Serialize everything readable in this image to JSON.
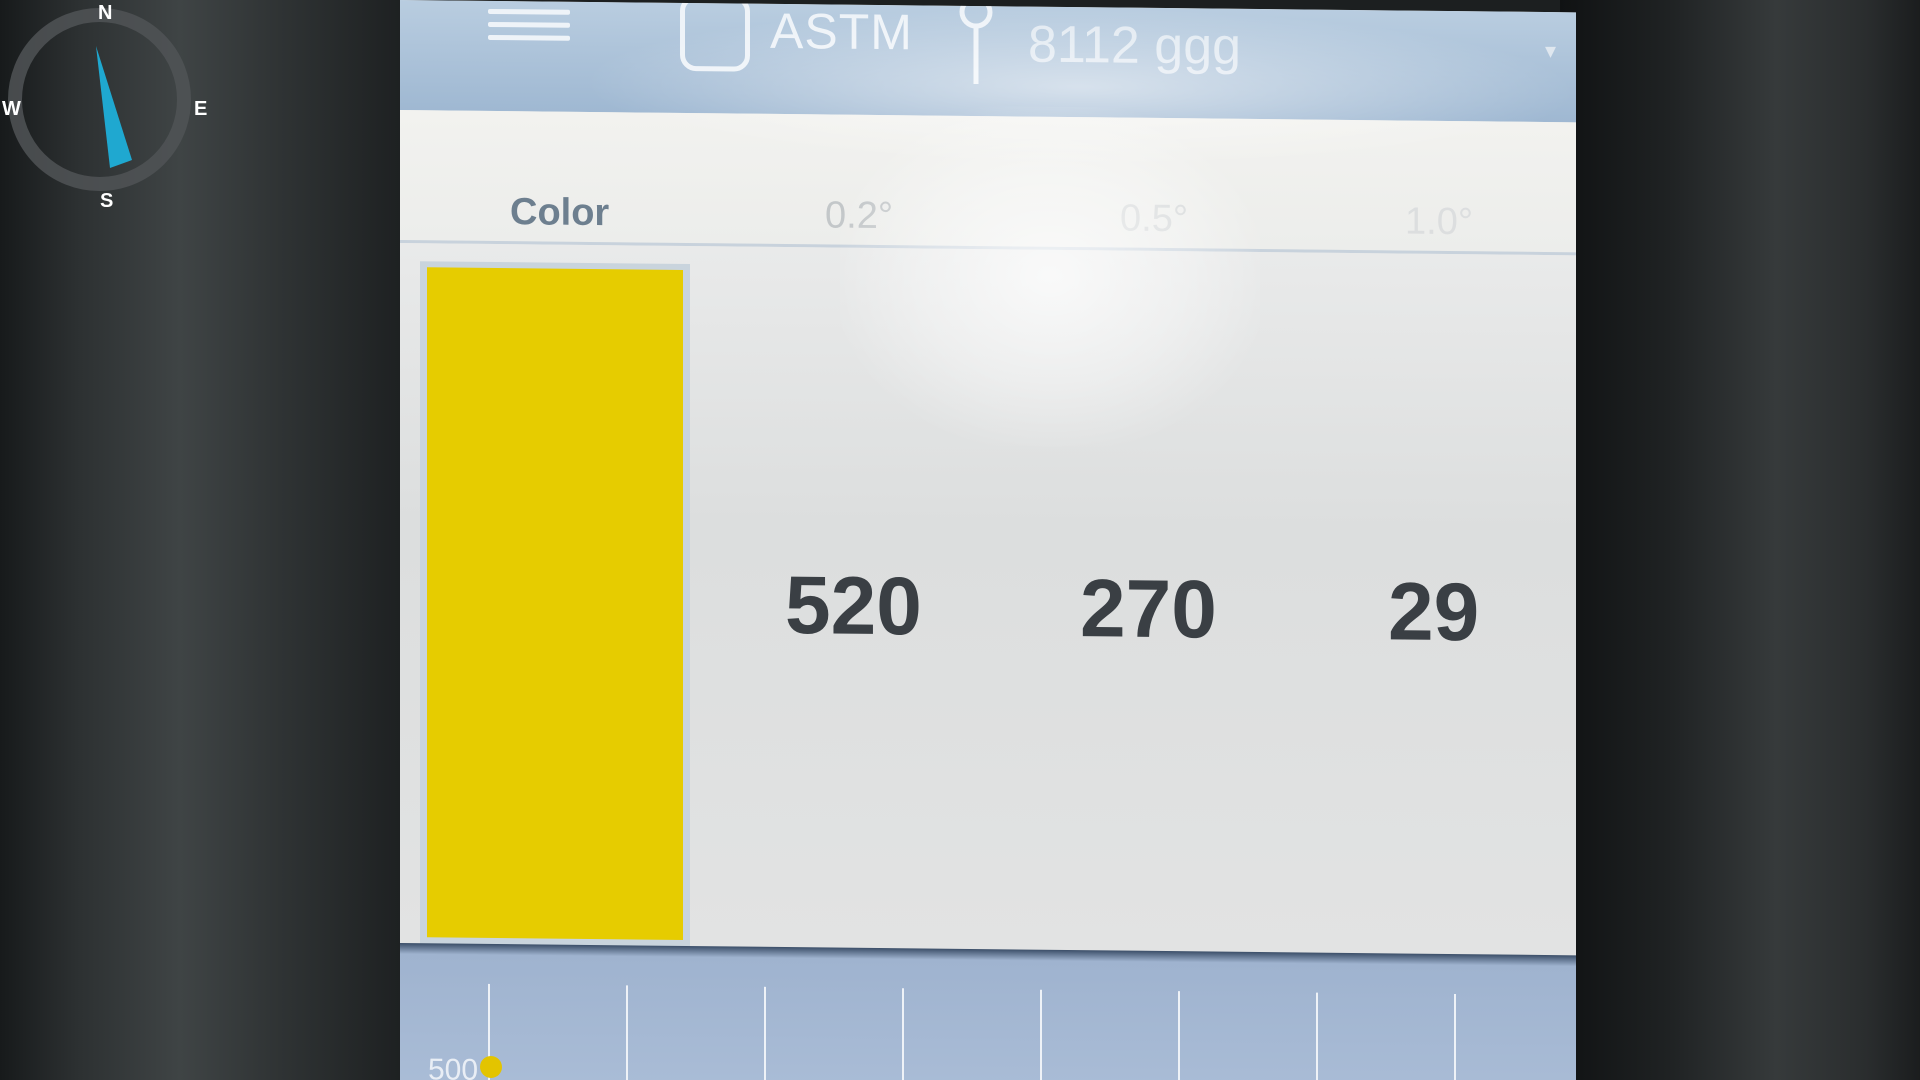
{
  "compass": {
    "north": "N",
    "south": "S",
    "west": "W",
    "east": "E",
    "needle_color": "#1fa8d0"
  },
  "app_bar": {
    "menu_icon": "hamburger-menu-icon",
    "device_icon": "device-icon",
    "title": "ASTM",
    "location_icon": "pin-icon",
    "sample_id": "8112 ggg"
  },
  "table": {
    "headers": [
      "Color",
      "0.2°",
      "0.5°",
      "1.0°"
    ],
    "swatch_color": "#e6cc00",
    "values": [
      "520",
      "270",
      "29"
    ]
  },
  "chart_strip": {
    "axis_label": "500"
  }
}
